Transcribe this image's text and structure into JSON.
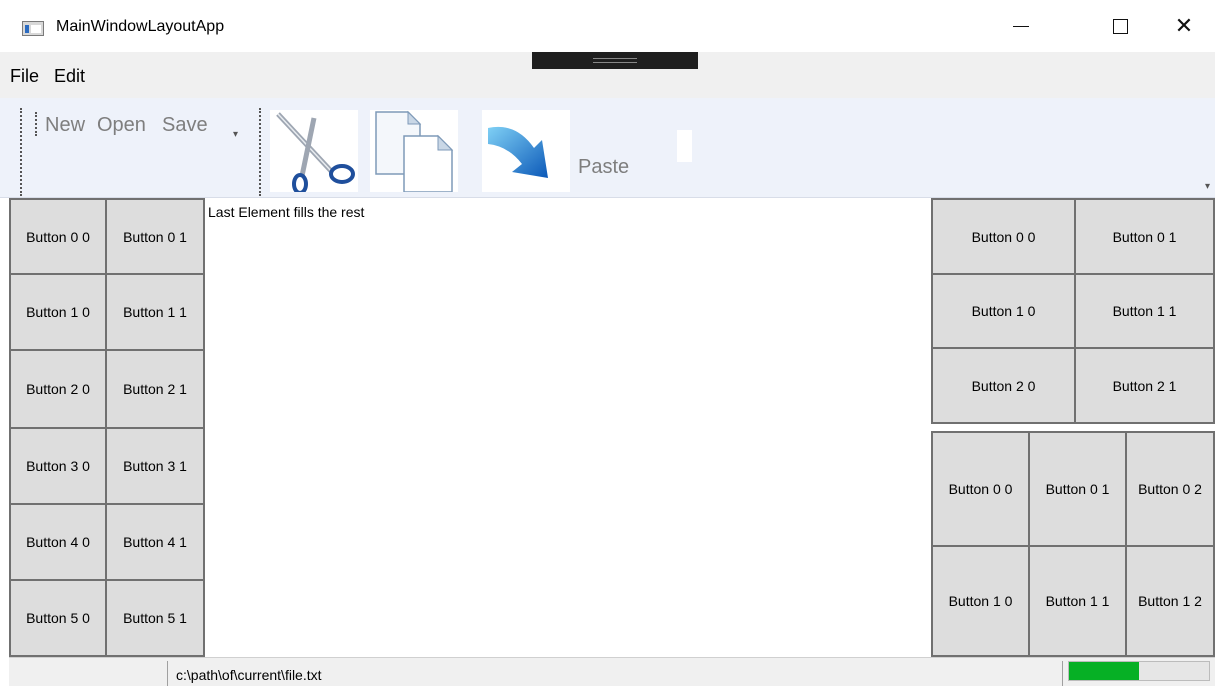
{
  "window": {
    "title": "MainWindowLayoutApp",
    "controls": {
      "minimize": "—",
      "maximize": "☐",
      "close": "✕"
    }
  },
  "menu": {
    "items": [
      "File",
      "Edit"
    ]
  },
  "toolbar": {
    "new_label": "New",
    "open_label": "Open",
    "save_label": "Save",
    "paste_label": "Paste",
    "icons": [
      "scissors-icon",
      "copy-icon",
      "paste-arrow-icon"
    ]
  },
  "left_grid": {
    "rows": [
      [
        "Button 0 0",
        "Button 0 1"
      ],
      [
        "Button 1 0",
        "Button 1 1"
      ],
      [
        "Button 2 0",
        "Button 2 1"
      ],
      [
        "Button 3 0",
        "Button 3 1"
      ],
      [
        "Button 4 0",
        "Button 4 1"
      ],
      [
        "Button 5 0",
        "Button 5 1"
      ]
    ]
  },
  "center": {
    "text": "Last Element fills the rest"
  },
  "right_top_grid": {
    "rows": [
      [
        "Button 0 0",
        "Button 0 1"
      ],
      [
        "Button 1 0",
        "Button 1 1"
      ],
      [
        "Button 2 0",
        "Button 2 1"
      ]
    ]
  },
  "right_bottom_grid": {
    "rows": [
      [
        "Button 0 0",
        "Button 0 1",
        "Button 0 2"
      ],
      [
        "Button 1 0",
        "Button 1 1",
        "Button 1 2"
      ]
    ]
  },
  "status": {
    "path": "c:\\path\\of\\current\\file.txt",
    "progress_percent": 50
  },
  "colors": {
    "progress": "#06b025",
    "button_face": "#dddddd",
    "button_border": "#707070",
    "toolbar_bg": "#eef2fa"
  }
}
